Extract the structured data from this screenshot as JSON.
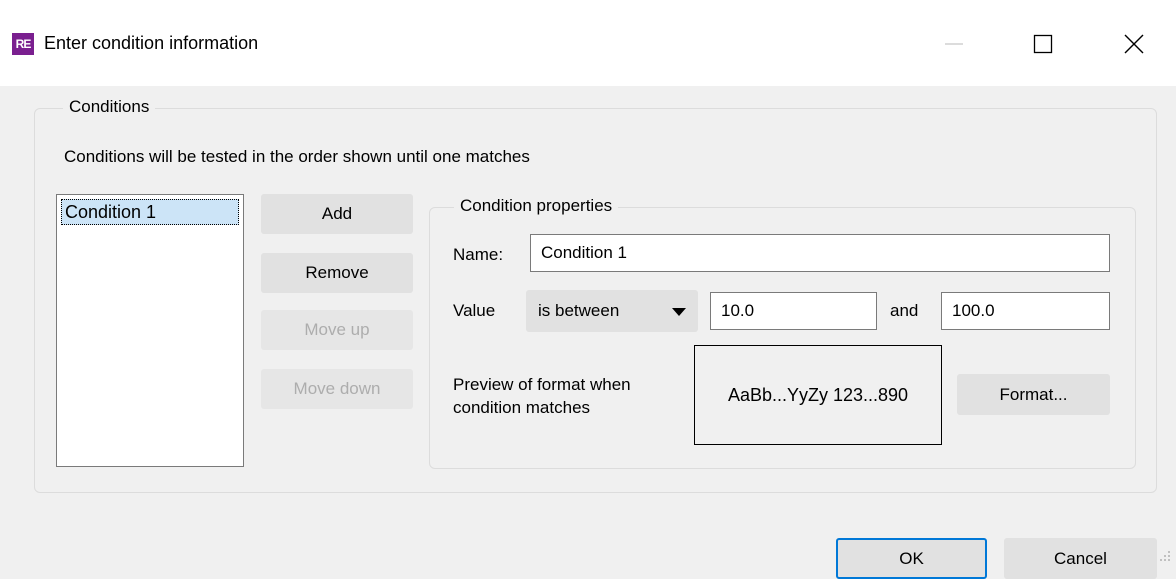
{
  "window": {
    "title": "Enter condition information",
    "app_icon_text": "RE",
    "accent_color": "#0078d7",
    "icon_color": "#7a1f8f"
  },
  "conditions": {
    "legend": "Conditions",
    "intro": "Conditions will be tested in the order shown until one matches",
    "list_items": [
      "Condition 1"
    ],
    "selected_index": 0
  },
  "buttons": {
    "add": "Add",
    "remove": "Remove",
    "move_up": "Move up",
    "move_down": "Move down"
  },
  "properties": {
    "legend": "Condition properties",
    "name_label": "Name:",
    "name_value": "Condition 1",
    "value_label": "Value",
    "operator": "is between",
    "min_value": "10.0",
    "and_label": "and",
    "max_value": "100.0",
    "preview_label_line1": "Preview of format when",
    "preview_label_line2": "condition matches",
    "preview_sample": "AaBb...YyZy 123...890",
    "format_button": "Format..."
  },
  "footer": {
    "ok": "OK",
    "cancel": "Cancel"
  }
}
